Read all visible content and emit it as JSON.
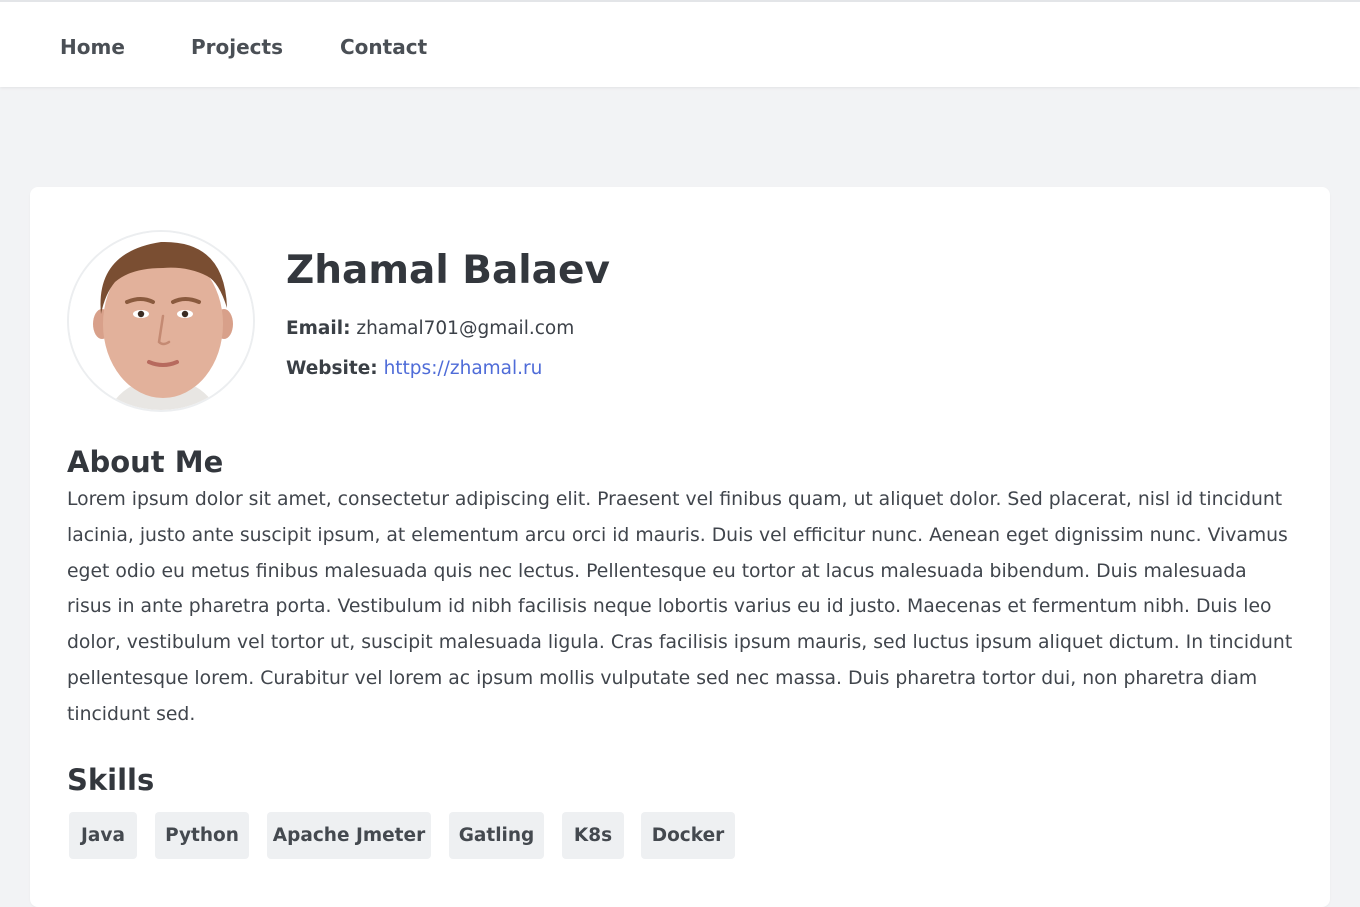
{
  "nav": {
    "items": [
      {
        "label": "Home"
      },
      {
        "label": "Projects"
      },
      {
        "label": "Contact"
      }
    ]
  },
  "profile": {
    "name": "Zhamal Balaev",
    "email_label": "Email:",
    "email": "zhamal701@gmail.com",
    "website_label": "Website:",
    "website": "https://zhamal.ru"
  },
  "about": {
    "heading": "About Me",
    "text": "Lorem ipsum dolor sit amet, consectetur adipiscing elit. Praesent vel finibus quam, ut aliquet dolor. Sed placerat, nisl id tincidunt lacinia, justo ante suscipit ipsum, at elementum arcu orci id mauris. Duis vel efficitur nunc. Aenean eget dignissim nunc. Vivamus eget odio eu metus finibus malesuada quis nec lectus. Pellentesque eu tortor at lacus malesuada bibendum. Duis malesuada risus in ante pharetra porta. Vestibulum id nibh facilisis neque lobortis varius eu id justo. Maecenas et fermentum nibh. Duis leo dolor, vestibulum vel tortor ut, suscipit malesuada ligula. Cras facilisis ipsum mauris, sed luctus ipsum aliquet dictum. In tincidunt pellentesque lorem. Curabitur vel lorem ac ipsum mollis vulputate sed nec massa. Duis pharetra tortor dui, non pharetra diam tincidunt sed."
  },
  "skills": {
    "heading": "Skills",
    "items": [
      "Java",
      "Python",
      "Apache Jmeter",
      "Gatling",
      "K8s",
      "Docker"
    ]
  },
  "colors": {
    "page_background": "#f2f3f5",
    "card_background": "#ffffff",
    "link": "#4f6cd8",
    "text": "#363b42",
    "chip_background": "#eef0f2"
  }
}
